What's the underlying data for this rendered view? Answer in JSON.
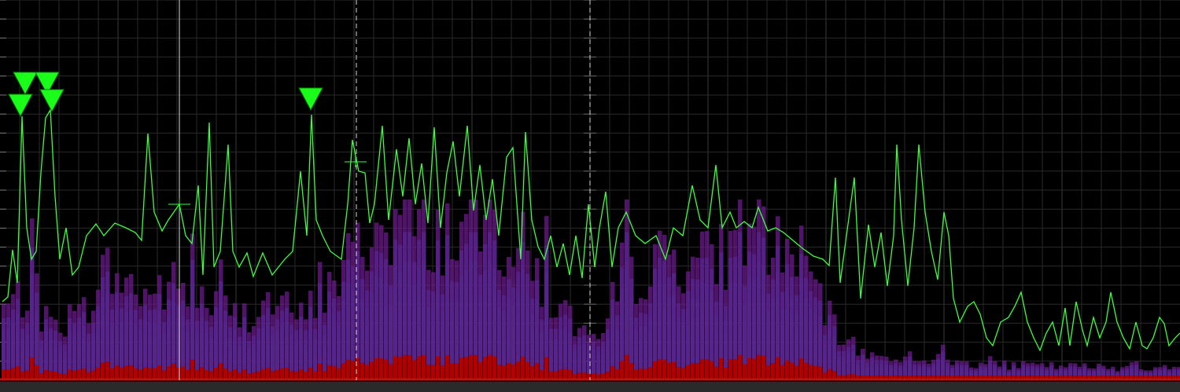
{
  "analyzer": {
    "background": "#000000",
    "grid_color": "#2a2a2a",
    "trace_color": "#3cff3c",
    "marker_color": "#1aff1a",
    "cursor_color": "#d8d8d8",
    "noise_floor_color": "#c01010",
    "footer_color": "#2a2a2a",
    "density_palette": [
      "#b00000",
      "#c05000",
      "#a8a000",
      "#30a030",
      "#108080",
      "#203890",
      "#6a1a8a"
    ],
    "markers": [
      {
        "name": "marker-1",
        "freq_fraction": 0.016,
        "level_fraction": 0.74
      },
      {
        "name": "marker-2",
        "freq_fraction": 0.021,
        "level_fraction": 0.8
      },
      {
        "name": "marker-3",
        "freq_fraction": 0.041,
        "level_fraction": 0.8
      },
      {
        "name": "marker-4",
        "freq_fraction": 0.045,
        "level_fraction": 0.74
      },
      {
        "name": "marker-5",
        "freq_fraction": 0.263,
        "level_fraction": 0.74
      }
    ],
    "cursors": [
      {
        "name": "cursor-solid",
        "style": "solid",
        "freq_fraction": 0.152
      },
      {
        "name": "cursor-dashed-1",
        "style": "dashed",
        "freq_fraction": 0.302
      },
      {
        "name": "cursor-dashed-2",
        "style": "dashed",
        "freq_fraction": 0.5
      }
    ]
  }
}
